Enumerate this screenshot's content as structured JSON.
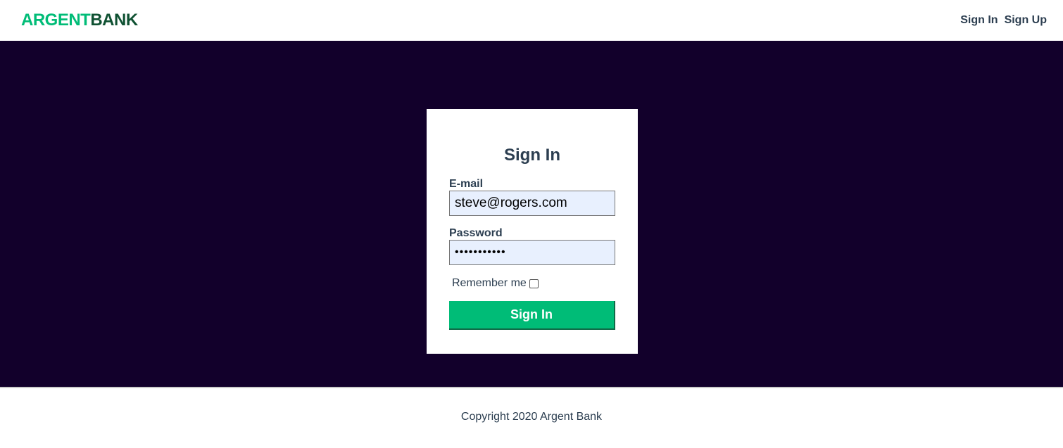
{
  "header": {
    "logo_part1": "ARGENT",
    "logo_part2": "BANK",
    "nav": {
      "sign_in": "Sign In",
      "sign_up": "Sign Up"
    }
  },
  "signin_form": {
    "title": "Sign In",
    "email_label": "E-mail",
    "email_value": "steve@rogers.com",
    "password_label": "Password",
    "password_value": "•••••••••••",
    "remember_label": "Remember me",
    "remember_checked": false,
    "submit_label": "Sign In"
  },
  "footer": {
    "copyright": "Copyright 2020 Argent Bank"
  },
  "colors": {
    "brand_green": "#00bc77",
    "brand_dark_green": "#0f5132",
    "hero_background": "#12002b",
    "text": "#2c3e50",
    "input_autofill_bg": "#e8f0fe"
  }
}
